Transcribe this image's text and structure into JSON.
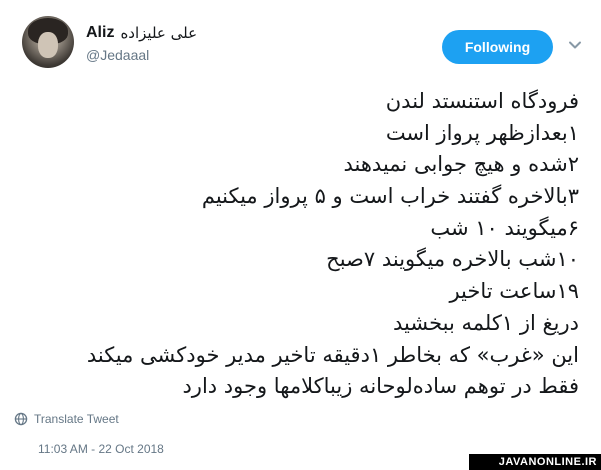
{
  "author": {
    "display_name": "Aliz",
    "display_name_fa": "علی علیزاده",
    "handle": "@Jedaaal"
  },
  "follow_button": {
    "label": "Following",
    "color": "#1da1f2"
  },
  "tweet": {
    "lines": [
      "فرودگاه استنستد لندن",
      "۱بعدازظهر پرواز است",
      "۲شده و هیچ جوابی نمیدهند",
      "۳بالاخره گفتند خراب است و ۵ پرواز میکنیم",
      "۶میگویند ۱۰ شب",
      "۱۰شب بالاخره میگویند ۷صبح",
      "۱۹ساعت تاخیر",
      "دریغ از ۱کلمه ببخشید",
      "این «غرب» که بخاطر ۱دقیقه تاخیر مدیر خودکشی میکند",
      "فقط در توهم ساده‌لوحانه زیباکلامها وجود دارد"
    ]
  },
  "translate_label": "Translate Tweet",
  "timestamp": "11:03 AM - 22 Oct 2018",
  "watermark": "JAVANONLINE.IR",
  "icons": {
    "menu": "chevron-down-icon",
    "translate": "globe-icon"
  }
}
